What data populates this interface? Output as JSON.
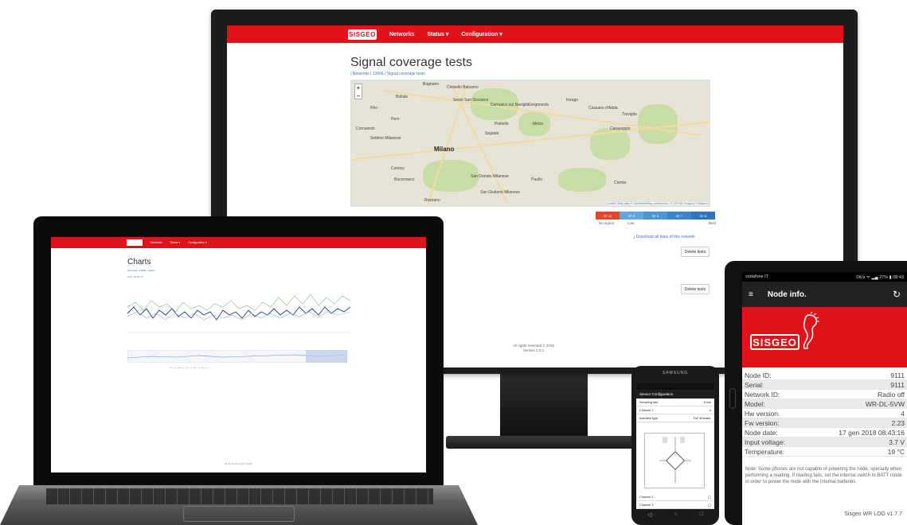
{
  "monitor": {
    "navbar": {
      "logo": "SISGEO",
      "links": [
        "Networks",
        "Status ▾",
        "Configuration ▾"
      ]
    },
    "page_title": "Signal coverage tests",
    "breadcrumb": "/ Networks / 13666 / Signal coverage tests",
    "map": {
      "zoom_in": "+",
      "zoom_out": "−",
      "attribution": "Leaflet | Map data © OpenStreetMap contributors, CC-BY-SA, Imagery © Mapbox",
      "places": [
        {
          "name": "Bugnano",
          "cls": "city-label"
        },
        {
          "name": "Cinisello Balsamo",
          "cls": "city-label"
        },
        {
          "name": "Bollate",
          "cls": "city-label"
        },
        {
          "name": "Sesto San Giovanni",
          "cls": "city-label"
        },
        {
          "name": "Cernusco sul Naviglio",
          "cls": "city-label"
        },
        {
          "name": "Gorgonzola",
          "cls": "city-label"
        },
        {
          "name": "Inzago",
          "cls": "city-label"
        },
        {
          "name": "Cassano d'Adda",
          "cls": "city-label"
        },
        {
          "name": "Treviglio",
          "cls": "city-label"
        },
        {
          "name": "Rho",
          "cls": "city-label"
        },
        {
          "name": "Pero",
          "cls": "city-label"
        },
        {
          "name": "Pioltello",
          "cls": "city-label"
        },
        {
          "name": "Melzo",
          "cls": "city-label"
        },
        {
          "name": "Segrate",
          "cls": "city-label"
        },
        {
          "name": "Cornaredo",
          "cls": "city-label"
        },
        {
          "name": "Settimo Milanese",
          "cls": "city-label"
        },
        {
          "name": "Milano",
          "cls": "city-label milano"
        },
        {
          "name": "Caravaggio",
          "cls": "city-label"
        },
        {
          "name": "Corsico",
          "cls": "city-label"
        },
        {
          "name": "Buccinasco",
          "cls": "city-label"
        },
        {
          "name": "San Donato Milanese",
          "cls": "city-label"
        },
        {
          "name": "Paullo",
          "cls": "city-label"
        },
        {
          "name": "Rozzano",
          "cls": "city-label"
        },
        {
          "name": "San Giuliano Milanese",
          "cls": "city-label"
        },
        {
          "name": "Crema",
          "cls": "city-label"
        }
      ]
    },
    "legend": {
      "segments": [
        {
          "label": "SF 10",
          "color": "#e8412c"
        },
        {
          "label": "SF 9",
          "color": "#5fa7e0"
        },
        {
          "label": "SF 8",
          "color": "#4b96d6"
        },
        {
          "label": "SF 7",
          "color": "#3a86cc"
        },
        {
          "label": "SF 6",
          "color": "#2e76bd"
        }
      ],
      "labels": [
        "No signal",
        "Low",
        "Best"
      ]
    },
    "download_link": "⤓ Download all tests of this network",
    "delete_buttons": [
      "Delete tests",
      "Delete tests"
    ],
    "footer": [
      "All rights reserved © 2018",
      "Version 1.0.1"
    ]
  },
  "laptop": {
    "nav_links": [
      "Networks",
      "Status ▾",
      "Configuration ▾"
    ],
    "page_title": "Charts",
    "breadcrumb": "Networks / 13666 / Charts",
    "range_buttons": "From  1d  3d  7d",
    "footer": "All rights reserved © 2018"
  },
  "phone_small": {
    "brand": "SAMSUNG",
    "title": "Sensor Configuration",
    "rows": [
      {
        "label": "Sampling rate",
        "value": "5 min"
      },
      {
        "label": "Channel 1",
        "value": "●"
      },
      {
        "label": "Interface type",
        "value": "Full Wheatst."
      },
      {
        "label": "Channel 2",
        "value": ""
      },
      {
        "label": "Channel 3",
        "value": ""
      }
    ],
    "nav_keys": [
      "◁",
      "○",
      "□"
    ]
  },
  "tablet": {
    "status": {
      "carrier": "vodafone IT",
      "right": "0K/s ᯤ ▂▄ 27% ▮ 08:43"
    },
    "header": {
      "menu": "≡",
      "title": "Node info.",
      "refresh": "↻"
    },
    "logo": "SISGEO",
    "info": [
      {
        "label": "Node ID:",
        "value": "9111"
      },
      {
        "label": "Serial:",
        "value": "9111"
      },
      {
        "label": "Network ID:",
        "value": "Radio off"
      },
      {
        "label": "Model:",
        "value": "WR-DL-5VW"
      },
      {
        "label": "Hw version:",
        "value": "4"
      },
      {
        "label": "Fw version:",
        "value": "2.23"
      },
      {
        "label": "Node date:",
        "value": "17 gen 2018 08:43:16"
      },
      {
        "label": "Input voltage:",
        "value": "3.7 V"
      },
      {
        "label": "Temperature:",
        "value": "19 °C"
      }
    ],
    "note": "Note: Some phones are not capable of powering the node, specially when performing a reading. If reading fails, set the internal switch to BATT mode in order to power the node with the internal batteries.",
    "version": "Sisgeo WR LOG v1.7.7"
  }
}
